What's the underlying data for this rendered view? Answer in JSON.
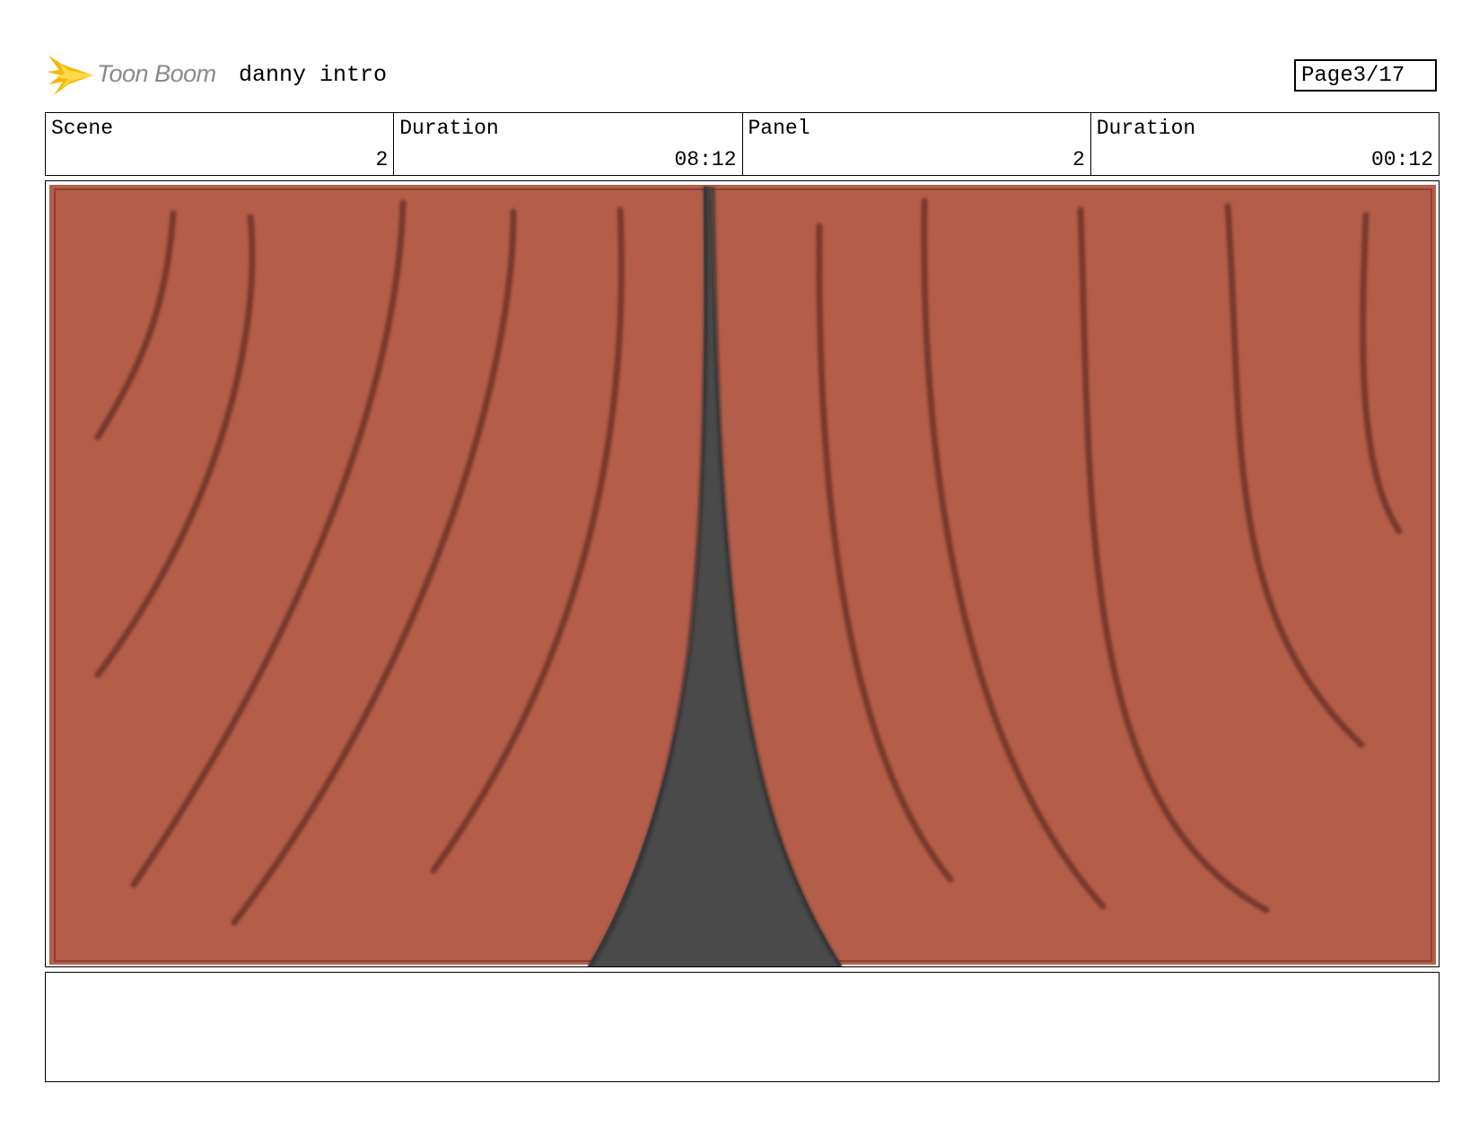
{
  "header": {
    "brand": "Toon Boom",
    "project_title": "danny intro",
    "page_label": "Page",
    "page_value": "3/17"
  },
  "info": {
    "scene_label": "Scene",
    "scene_value": "2",
    "scene_duration_label": "Duration",
    "scene_duration_value": "08:12",
    "panel_label": "Panel",
    "panel_value": "2",
    "panel_duration_label": "Duration",
    "panel_duration_value": "00:12"
  },
  "colors": {
    "curtain": "#b45e4a",
    "fold_lines": "#6e3125",
    "gap": "#4a4a4a",
    "logo_yellow": "#f5b800",
    "brand_gray": "#8a8a8a"
  },
  "icons": {
    "logo": "starburst-logo-icon"
  },
  "notes": ""
}
